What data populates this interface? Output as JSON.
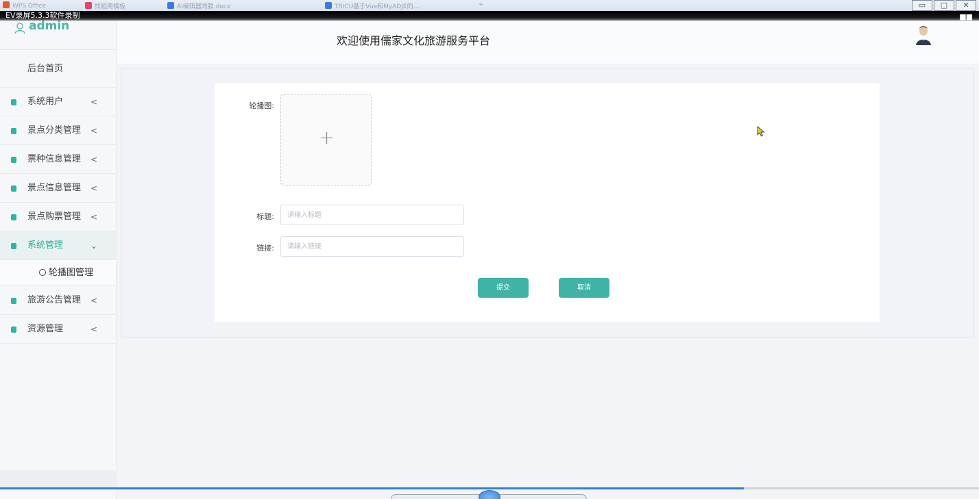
{
  "os_taskbar": {
    "tabs": [
      "WPS Office",
      "找稻壳模板",
      "AI编辑器同款.docx",
      "TRICU基于Vue和MyADJE的…",
      "+"
    ],
    "colors": {
      "bar": "#dde5ef"
    }
  },
  "recorder": {
    "label": "EV录屏5.3.3软件录制",
    "grid_icon": "grid-icon"
  },
  "sidebar": {
    "user": {
      "icon": "user-icon",
      "name": "admin"
    },
    "home_label": "后台首页",
    "items": [
      {
        "label": "系统用户",
        "chevron": "<",
        "active": false
      },
      {
        "label": "景点分类管理",
        "chevron": "<",
        "active": false
      },
      {
        "label": "票种信息管理",
        "chevron": "<",
        "active": false
      },
      {
        "label": "景点信息管理",
        "chevron": "<",
        "active": false
      },
      {
        "label": "景点购票管理",
        "chevron": "<",
        "active": false
      },
      {
        "label": "系统管理",
        "chevron": "⌄",
        "active": true
      },
      {
        "label": "旅游公告管理",
        "chevron": "<",
        "active": false
      },
      {
        "label": "资源管理",
        "chevron": "<",
        "active": false
      }
    ],
    "sub_item": {
      "label": "轮播图管理",
      "icon": "check-circle-icon"
    }
  },
  "header": {
    "title": "欢迎使用儒家文化旅游服务平台",
    "avatar": "avatar"
  },
  "form": {
    "carousel_label": "轮播图:",
    "upload_icon": "plus-icon",
    "title_label": "标题:",
    "title_placeholder": "请输入标题",
    "title_value": "",
    "link_label": "链接:",
    "link_placeholder": "请输入链接",
    "link_value": "",
    "submit_label": "提交",
    "cancel_label": "取消"
  },
  "recording_progress": 0.76,
  "colors": {
    "accent": "#3fb3a6",
    "active_text": "#2aaa98",
    "menu_icon": "#2fb4a0",
    "username": "#4db3a8"
  }
}
